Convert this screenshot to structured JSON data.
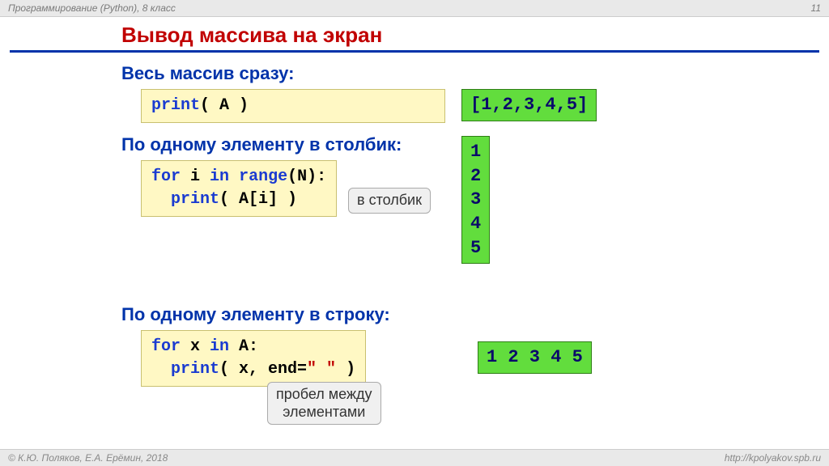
{
  "header": {
    "left": "Программирование (Python), 8 класс",
    "pagenum": "11"
  },
  "footer": {
    "left": "© К.Ю. Поляков, Е.А. Ерёмин, 2018",
    "right": "http://kpolyakov.spb.ru"
  },
  "title": "Вывод массива на экран",
  "section1": {
    "heading": "Весь массив сразу:",
    "code_l1a": "print",
    "code_l1b": "( A )",
    "output": "[1,2,3,4,5]"
  },
  "section2": {
    "heading": "По одному элементу в столбик:",
    "c_l1a": "for",
    "c_l1b": " i ",
    "c_l1c": "in",
    "c_l1d": " ",
    "c_l1e": "range",
    "c_l1f": "(N):",
    "c_l2a": "  print",
    "c_l2b": "( A[i] )",
    "output": "1\n2\n3\n4\n5",
    "callout": "в столбик"
  },
  "section3": {
    "heading": "По одному элементу в строку:",
    "c_l1a": "for",
    "c_l1b": " x ",
    "c_l1c": "in",
    "c_l1d": " A:",
    "c_l2a": "  print",
    "c_l2b": "( x, end=",
    "c_l2c": "\" \"",
    "c_l2d": " )",
    "output": "1 2 3 4 5",
    "callout": "пробел между\nэлементами"
  }
}
